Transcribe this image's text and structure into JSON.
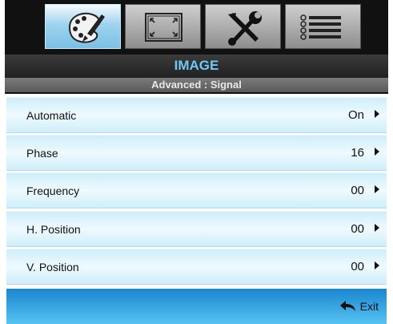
{
  "tabs": [
    {
      "name": "image",
      "icon": "palette-brush-icon",
      "active": true
    },
    {
      "name": "display",
      "icon": "screen-expand-icon",
      "active": false
    },
    {
      "name": "setup",
      "icon": "tools-icon",
      "active": false
    },
    {
      "name": "options",
      "icon": "list-icon",
      "active": false
    }
  ],
  "header": {
    "title": "IMAGE",
    "subtitle": "Advanced : Signal"
  },
  "rows": [
    {
      "label": "Automatic",
      "value": "On"
    },
    {
      "label": "Phase",
      "value": "16"
    },
    {
      "label": "Frequency",
      "value": "00"
    },
    {
      "label": "H. Position",
      "value": "00"
    },
    {
      "label": "V. Position",
      "value": "00"
    }
  ],
  "footer": {
    "exit_label": "Exit",
    "exit_icon": "return-arrow-icon"
  },
  "colors": {
    "accent_title": "#6ec9f5",
    "row_bg": "#dff4fc",
    "footer_bg": "#2fa2df",
    "active_tab": "#9fd3ee"
  }
}
